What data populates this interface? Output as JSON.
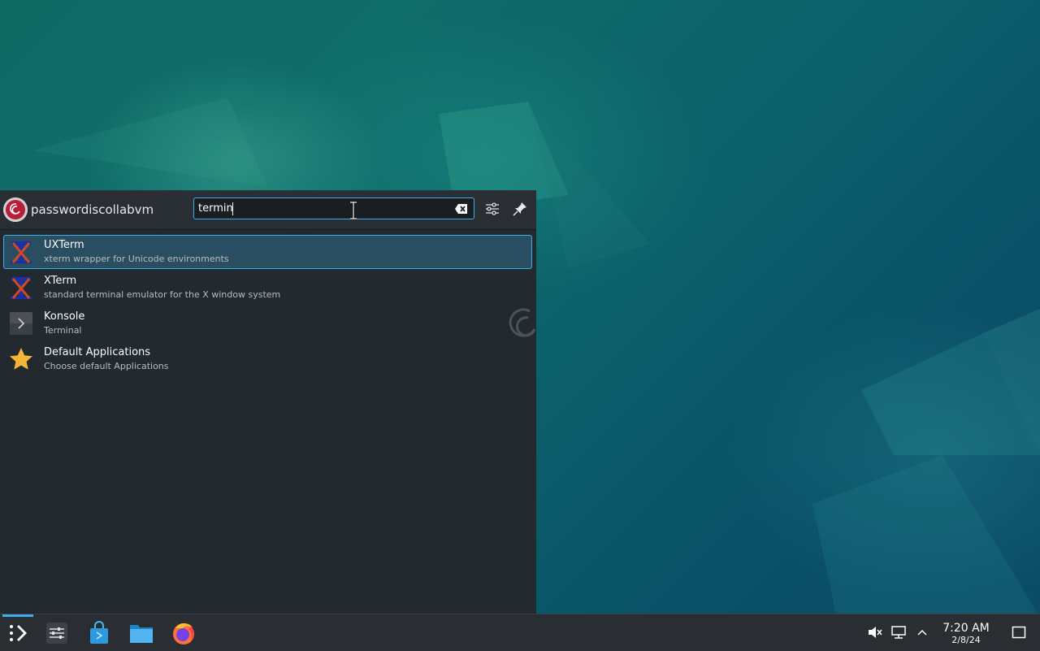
{
  "launcher": {
    "username": "passwordiscollabvm",
    "search": {
      "value": "termin"
    },
    "results": [
      {
        "name": "UXTerm",
        "description": "xterm wrapper for Unicode environments",
        "icon": "xterm-icon"
      },
      {
        "name": "XTerm",
        "description": "standard terminal emulator for the X window system",
        "icon": "xterm-icon"
      },
      {
        "name": "Konsole",
        "description": "Terminal",
        "icon": "konsole-icon"
      },
      {
        "name": "Default Applications",
        "description": "Choose default Applications",
        "icon": "star-icon"
      }
    ]
  },
  "taskbar": {
    "items": [
      "application-launcher-icon",
      "system-settings-icon",
      "discover-store-icon",
      "file-manager-icon",
      "firefox-icon"
    ],
    "tray": [
      "volume-muted-icon",
      "network-icon",
      "tray-expand-icon"
    ],
    "clock": {
      "time": "7:20 AM",
      "date": "2/8/24"
    },
    "show_desktop": "show-desktop-icon"
  },
  "colors": {
    "accent": "#3daee9",
    "panel": "#2a2e32",
    "launcher_bg": "#23282d"
  }
}
